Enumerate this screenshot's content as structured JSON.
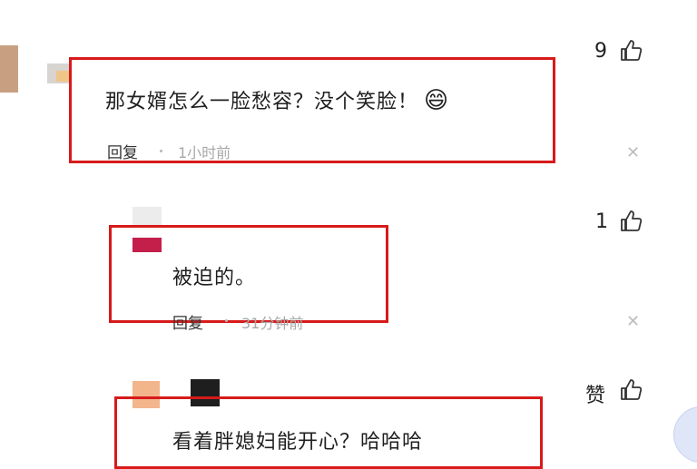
{
  "comments": [
    {
      "text": "那女婿怎么一脸愁容？没个笑脸！",
      "emoji": "😄",
      "reply_label": "回复",
      "time": "1小时前",
      "likes": "9"
    },
    {
      "text": "被迫的。",
      "reply_label": "回复",
      "time": "31分钟前",
      "likes": "1"
    },
    {
      "text": "看着胖媳妇能开心？哈哈哈",
      "likes": "赞"
    }
  ],
  "icons": {
    "like": "thumbs-up-icon",
    "close": "close-icon"
  },
  "colors": {
    "highlight_box": "#d71a1a",
    "timestamp": "#a8a8a8"
  }
}
